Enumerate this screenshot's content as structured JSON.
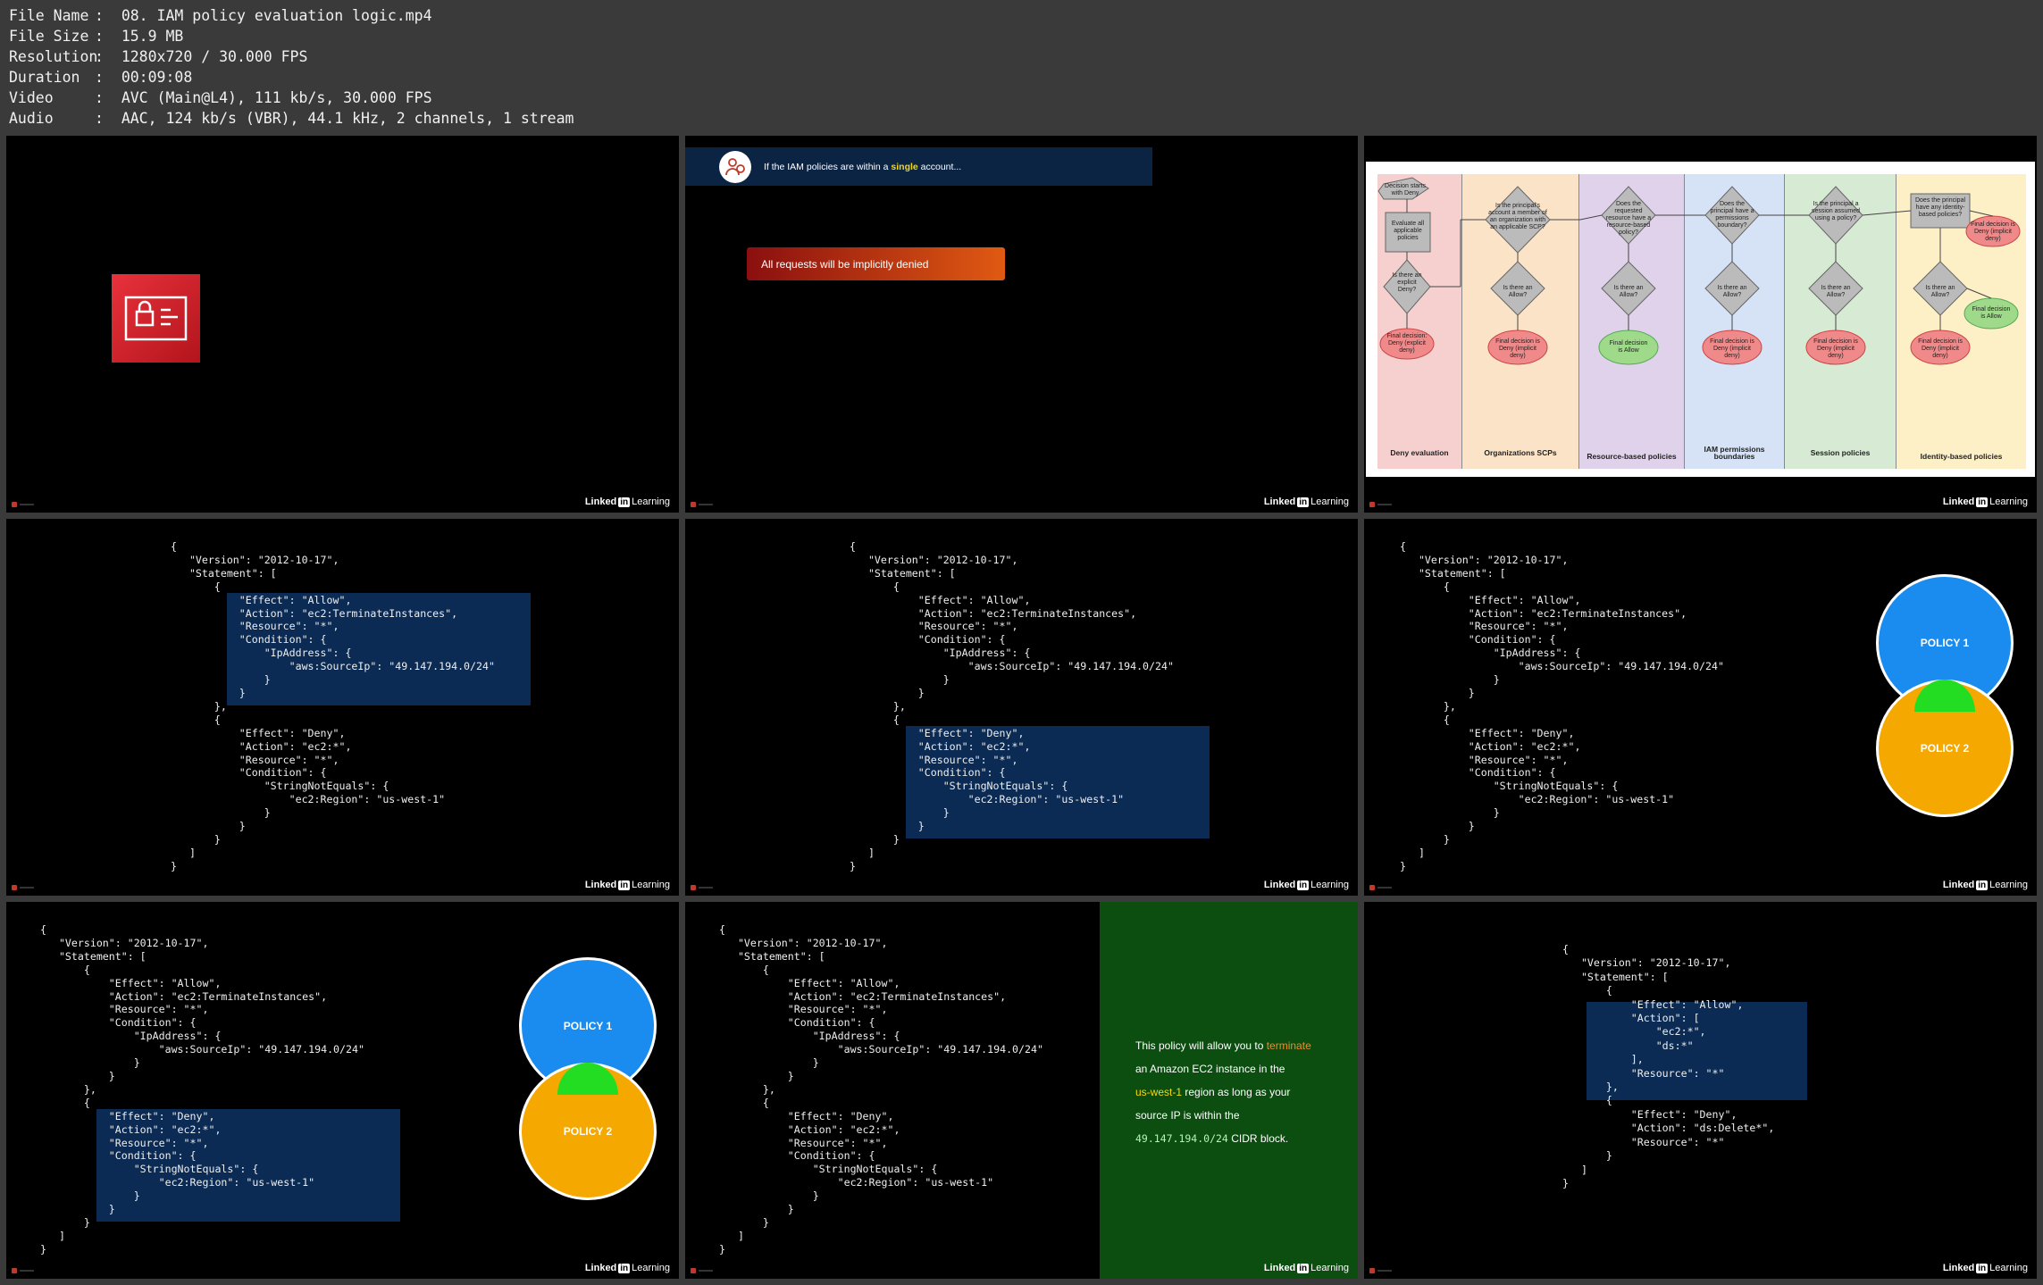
{
  "file_info": [
    {
      "key": "File Name",
      "value": "08. IAM policy evaluation logic.mp4"
    },
    {
      "key": "File Size",
      "value": "15.9 MB"
    },
    {
      "key": "Resolution",
      "value": "1280x720 / 30.000 FPS"
    },
    {
      "key": "Duration",
      "value": "00:09:08"
    },
    {
      "key": "Video",
      "value": "AVC (Main@L4), 111 kb/s, 30.000 FPS"
    },
    {
      "key": "Audio",
      "value": "AAC, 124 kb/s (VBR), 44.1 kHz, 2 channels, 1 stream"
    }
  ],
  "separator": ":",
  "brand": {
    "linked": "Linked",
    "in": "in",
    "learning": "Learning"
  },
  "tile2": {
    "banner_pre": "If the IAM policies are within a ",
    "banner_em": "single",
    "banner_post": " account...",
    "button": "All requests will be implicitly denied"
  },
  "flowchart": {
    "columns": [
      {
        "label": "Deny evaluation",
        "color": "#f6cfcf"
      },
      {
        "label": "Organizations SCPs",
        "color": "#fbe3c7"
      },
      {
        "label": "Resource-based policies",
        "color": "#e0d2ea"
      },
      {
        "label": "IAM permissions boundaries",
        "color": "#d6e3f7"
      },
      {
        "label": "Session policies",
        "color": "#d7ead4"
      },
      {
        "label": "Identity-based policies",
        "color": "#fdf0c7"
      }
    ],
    "start": "Decision starts with Deny",
    "evaluate": "Evaluate all applicable policies",
    "explicit_deny_q": "Is there an explicit Deny?",
    "explicit_deny_result": "Final decision: Deny (explicit deny)",
    "col_questions": [
      "Is the principal's account a member of an organization with an applicable SCP?",
      "Does the requested resource have a resource-based policy?",
      "Does the principal have a permissions boundary?",
      "Is the principal a session assumed using a policy?",
      "Does the principal have any identity-based policies?"
    ],
    "allow_q": "Is there an Allow?",
    "deny_result": "Final decision is Deny (implicit deny)",
    "resource_allow": "Final decision is Allow",
    "identity_allow": "Final decision is Allow",
    "identity_deny_top": "Final decision is Deny (implicit deny)",
    "yes": "Yes",
    "no": "No"
  },
  "policy_code": "{\n   \"Version\": \"2012-10-17\",\n   \"Statement\": [\n       {\n           \"Effect\": \"Allow\",\n           \"Action\": \"ec2:TerminateInstances\",\n           \"Resource\": \"*\",\n           \"Condition\": {\n               \"IpAddress\": {\n                   \"aws:SourceIp\": \"49.147.194.0/24\"\n               }\n           }\n       },\n       {\n           \"Effect\": \"Deny\",\n           \"Action\": \"ec2:*\",\n           \"Resource\": \"*\",\n           \"Condition\": {\n               \"StringNotEquals\": {\n                   \"ec2:Region\": \"us-west-1\"\n               }\n           }\n       }\n   ]\n}",
  "policy_code2": "{\n   \"Version\": \"2012-10-17\",\n   \"Statement\": [\n       {\n           \"Effect\": \"Allow\",\n           \"Action\": [\n               \"ec2:*\",\n               \"ds:*\"\n           ],\n           \"Resource\": \"*\"\n       },\n       {\n           \"Effect\": \"Deny\",\n           \"Action\": \"ds:Delete*\",\n           \"Resource\": \"*\"\n       }\n   ]\n}",
  "venn": {
    "policy1": "POLICY 1",
    "policy2": "POLICY 2",
    "color1": "#1a8cf0",
    "color2": "#f5a800",
    "overlap": "#22dd22"
  },
  "explain": {
    "t1": "This policy will allow you to ",
    "t1_em": "terminate",
    "t2": "an Amazon EC2 instance in the",
    "t3_em": "us-west-1",
    "t3": " region as long as your",
    "t4": "source IP is within the",
    "t5_code": "49.147.194.0/24",
    "t5": " CIDR block."
  }
}
